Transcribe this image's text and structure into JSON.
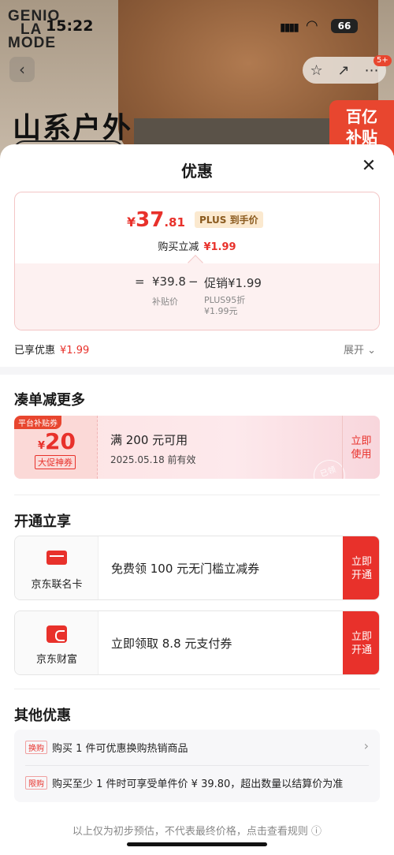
{
  "status": {
    "time": "15:22",
    "battery": "66"
  },
  "background": {
    "brand": [
      "GENIO",
      "LA",
      "MODE"
    ],
    "title": "山系户外",
    "subsidy": [
      "百亿",
      "补贴"
    ],
    "cart_badge": "5+"
  },
  "sheet": {
    "title": "优惠",
    "price": {
      "currency": "¥",
      "integer": "37",
      "decimal": ".81",
      "plus_tag": "PLUS 到手价",
      "reduce_label": "购买立减",
      "reduce_amount": "¥1.99",
      "formula": {
        "eq": "=",
        "subsidy_price": "¥39.8",
        "minus": "−",
        "promo": "促销¥1.99",
        "subsidy_label": "补贴价",
        "promo_label_1": "PLUS95折",
        "promo_label_2": "¥1.99元"
      }
    },
    "enjoyed_label": "已享优惠",
    "enjoyed_amount": "¥1.99",
    "expand_label": "展开 ⌄",
    "more_section": {
      "title": "凑单减更多",
      "coupon": {
        "tag": "平台补贴券",
        "currency": "¥",
        "value": "20",
        "sub": "大促神券",
        "condition": "满 200 元可用",
        "date": "2025.05.18 前有效",
        "action": [
          "立即",
          "使用"
        ],
        "stamp": "已领"
      }
    },
    "open_section": {
      "title": "开通立享",
      "offers": [
        {
          "name": "京东联名卡",
          "desc": "免费领 100 元无门槛立减券",
          "action": [
            "立即",
            "开通"
          ]
        },
        {
          "name": "京东财富",
          "desc": "立即领取 8.8 元支付券",
          "action": [
            "立即",
            "开通"
          ]
        }
      ]
    },
    "other_section": {
      "title": "其他优惠",
      "rows": [
        {
          "label": "换购",
          "text": "购买 1 件可优惠换购热销商品"
        },
        {
          "label": "限购",
          "text": "购买至少 1 件时可享受单件价 ¥ 39.80，超出数量以结算价为准"
        }
      ]
    },
    "footer": "以上仅为初步预估，不代表最终价格，点击查看规则 ⓘ"
  },
  "colors": {
    "accent": "#e8312b",
    "tag_bg": "#fbe9cf"
  }
}
